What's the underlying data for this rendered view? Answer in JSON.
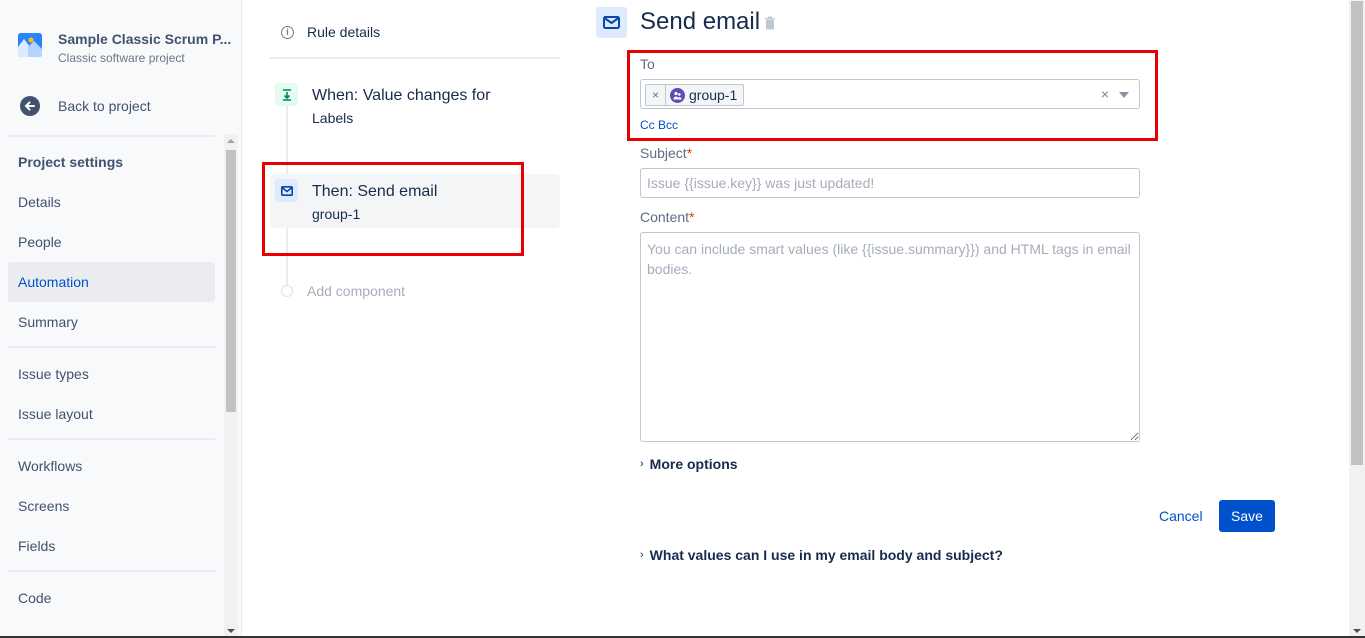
{
  "sidebar": {
    "project_name": "Sample Classic Scrum P...",
    "project_type": "Classic software project",
    "back_label": "Back to project",
    "heading": "Project settings",
    "groups": [
      [
        "Details",
        "People",
        "Automation",
        "Summary"
      ],
      [
        "Issue types",
        "Issue layout"
      ],
      [
        "Workflows",
        "Screens",
        "Fields"
      ],
      [
        "Code"
      ]
    ],
    "active_item": "Automation"
  },
  "rule": {
    "details_label": "Rule details",
    "trigger": {
      "title": "When: Value changes for",
      "subtitle": "Labels"
    },
    "action": {
      "title": "Then: Send email",
      "subtitle": "group-1"
    },
    "add_component_label": "Add component"
  },
  "main": {
    "title": "Send email",
    "to_label": "To",
    "to_recipients": [
      "group-1"
    ],
    "cc_bcc_label": "Cc Bcc",
    "subject_label": "Subject",
    "subject_value": "",
    "subject_placeholder": "Issue {{issue.key}} was just updated!",
    "content_label": "Content",
    "content_value": "",
    "content_placeholder": "You can include smart values (like {{issue.summary}}) and HTML tags in email bodies.",
    "required_marker": "*",
    "more_options_label": "More options",
    "cancel_label": "Cancel",
    "save_label": "Save",
    "help_label": "What values can I use in my email body and subject?"
  },
  "colors": {
    "accent": "#0052cc",
    "highlight_box": "#e60000",
    "trigger_icon_bg": "#e3fcef",
    "action_icon_bg": "#deebff",
    "group_avatar": "#5e4db2"
  }
}
